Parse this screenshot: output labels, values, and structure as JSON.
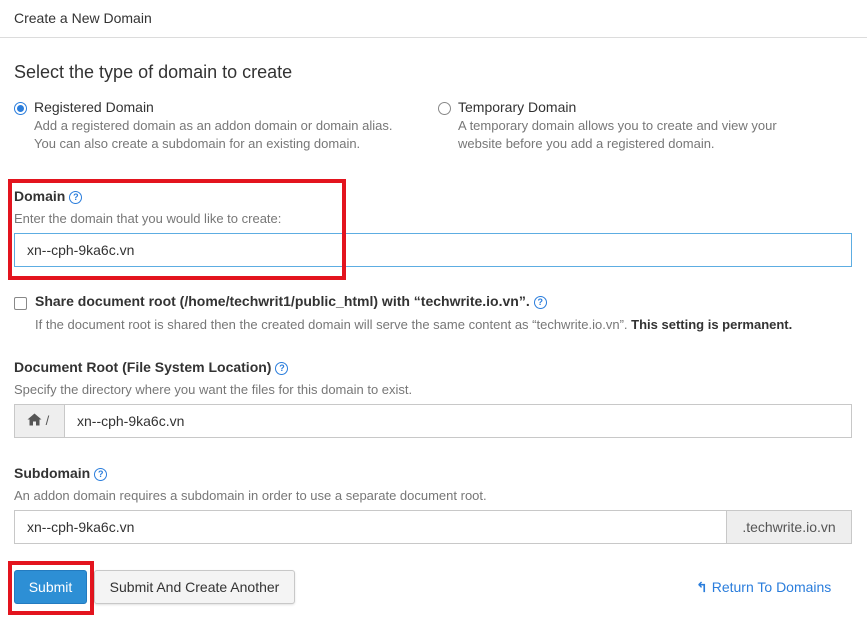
{
  "header": {
    "title": "Create a New Domain"
  },
  "section": {
    "title": "Select the type of domain to create"
  },
  "domain_type": {
    "registered": {
      "label": "Registered Domain",
      "desc_line1": "Add a registered domain as an addon domain or domain alias.",
      "desc_line2": "You can also create a subdomain for an existing domain.",
      "selected": true
    },
    "temporary": {
      "label": "Temporary Domain",
      "desc_line1": "A temporary domain allows you to create and view your",
      "desc_line2": "website before you add a registered domain.",
      "selected": false
    }
  },
  "domain": {
    "label": "Domain",
    "help": "Enter the domain that you would like to create:",
    "value": "xn--cph-9ka6c.vn"
  },
  "share_root": {
    "label": "Share document root (/home/techwrit1/public_html) with “techwrite.io.vn”.",
    "desc": "If the document root is shared then the created domain will serve the same content as “techwrite.io.vn”.",
    "desc_strong": "This setting is permanent.",
    "checked": false
  },
  "document_root": {
    "label": "Document Root (File System Location)",
    "help": "Specify the directory where you want the files for this domain to exist.",
    "prefix": "/",
    "value": "xn--cph-9ka6c.vn"
  },
  "subdomain": {
    "label": "Subdomain",
    "help": "An addon domain requires a subdomain in order to use a separate document root.",
    "value": "xn--cph-9ka6c.vn",
    "suffix": ".techwrite.io.vn"
  },
  "buttons": {
    "submit": "Submit",
    "submit_another": "Submit And Create Another",
    "return": "Return To Domains"
  },
  "icons": {
    "home": "home-icon",
    "help": "question-circle-icon",
    "return": "return-arrow-icon"
  },
  "colors": {
    "primary": "#2d8fd5",
    "link": "#2a7ddc",
    "highlight": "#e3141e"
  }
}
